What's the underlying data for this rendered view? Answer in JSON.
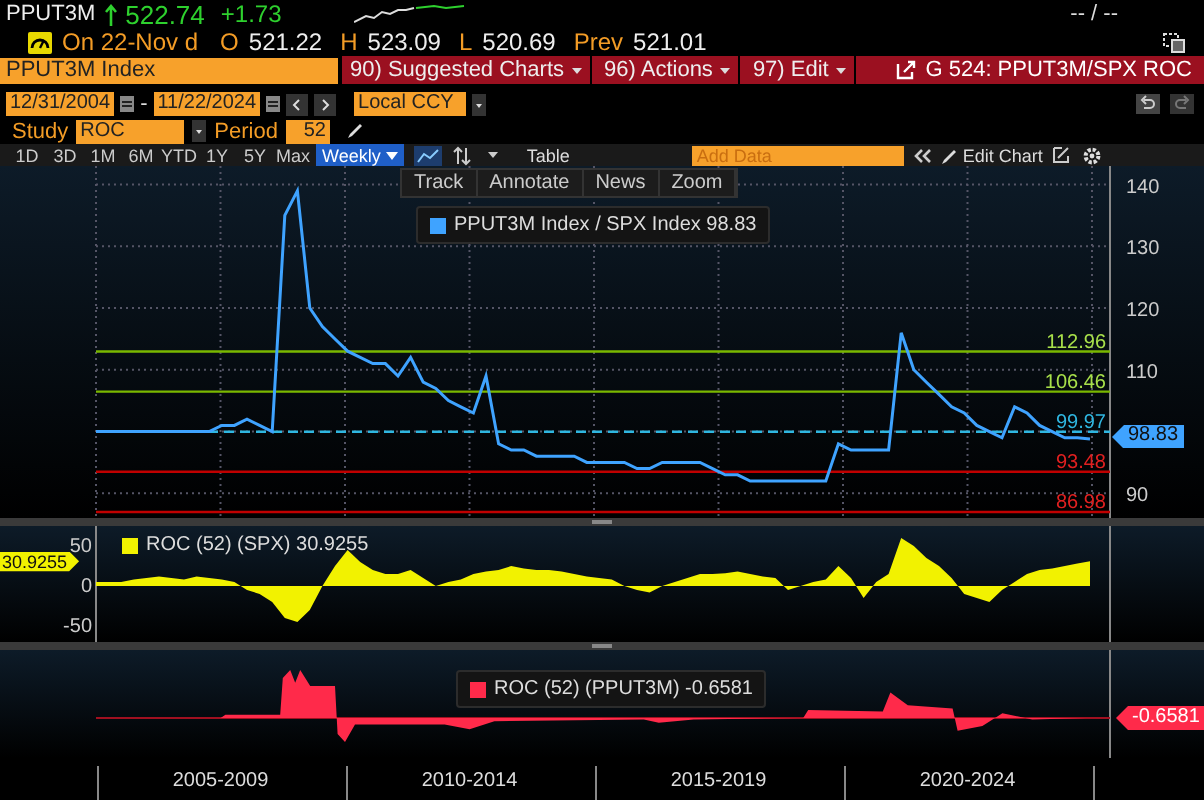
{
  "quote": {
    "ticker": "PPUT3M",
    "last": "522.74",
    "change": "+1.73",
    "bid_ask": "-- / --",
    "date": "On 22-Nov d",
    "fields": [
      {
        "label": "O",
        "value": "521.22"
      },
      {
        "label": "H",
        "value": "523.09"
      },
      {
        "label": "L",
        "value": "520.69"
      },
      {
        "label": "Prev",
        "value": "521.01"
      }
    ]
  },
  "toolbar": {
    "security": "PPUT3M Index",
    "menus": [
      {
        "number": "90)",
        "label": "Suggested Charts"
      },
      {
        "number": "96)",
        "label": "Actions"
      },
      {
        "number": "97)",
        "label": "Edit"
      }
    ],
    "chart_title": "G 524: PPUT3M/SPX ROC"
  },
  "range": {
    "start": "12/31/2004",
    "separator": "-",
    "end": "11/22/2024",
    "currency": "Local CCY"
  },
  "study": {
    "label": "Study",
    "value": "ROC",
    "period_label": "Period",
    "period": "52"
  },
  "periods": [
    {
      "label": "1D",
      "selected": false
    },
    {
      "label": "3D",
      "selected": false
    },
    {
      "label": "1M",
      "selected": false
    },
    {
      "label": "6M",
      "selected": false
    },
    {
      "label": "YTD",
      "selected": false
    },
    {
      "label": "1Y",
      "selected": false
    },
    {
      "label": "5Y",
      "selected": false
    },
    {
      "label": "Max",
      "selected": false
    }
  ],
  "frequency": "Weekly",
  "table_label": "Table",
  "add_data_placeholder": "Add Data",
  "edit_chart": "Edit Chart",
  "chart_tools": [
    "Track",
    "Annotate",
    "News",
    "Zoom"
  ],
  "main_chart": {
    "legend_value": "98.83",
    "tag_value": "98.83",
    "chart_data": {
      "type": "line",
      "grid": true,
      "series": [
        {
          "name": "PPUT3M Index / SPX Index",
          "color": "#3fa3ff",
          "values": [
            100,
            100,
            100,
            100,
            100,
            100,
            100,
            100,
            100,
            100,
            101,
            101,
            102,
            101,
            100,
            135,
            139,
            120,
            117,
            115,
            113,
            112,
            111,
            111,
            109,
            112,
            108,
            107,
            105,
            104,
            103,
            109,
            98,
            97,
            97,
            96,
            96,
            96,
            96,
            95,
            95,
            95,
            95,
            94,
            94,
            95,
            95,
            95,
            95,
            94,
            93,
            93,
            92,
            92,
            92,
            92,
            92,
            92,
            92,
            98,
            97,
            97,
            97,
            97,
            116,
            110,
            108,
            106,
            104,
            103,
            101,
            100,
            99,
            104,
            103,
            101,
            100,
            99,
            99,
            98.8
          ]
        }
      ],
      "ylim": [
        86,
        143
      ],
      "yticks": [
        90,
        110,
        120,
        130,
        140
      ],
      "ref_lines": [
        {
          "axis": "y",
          "value": 112.96,
          "label": "112.96",
          "color": "#7ab800"
        },
        {
          "axis": "y",
          "value": 106.46,
          "label": "106.46",
          "color": "#7ab800"
        },
        {
          "axis": "y",
          "value": 99.97,
          "label": "99.97",
          "color": "#2fb6e0"
        },
        {
          "axis": "y",
          "value": 93.48,
          "label": "93.48",
          "color": "#c00000"
        },
        {
          "axis": "y",
          "value": 86.98,
          "label": "86.98",
          "color": "#c00000"
        }
      ]
    }
  },
  "roc_spx": {
    "legend_value": "30.9255",
    "tag_value": "30.9255",
    "chart_data": {
      "type": "area",
      "series": [
        {
          "name": "ROC (52) (SPX)",
          "color": "#f2f200",
          "values": [
            5,
            5,
            5,
            8,
            10,
            12,
            10,
            8,
            12,
            10,
            8,
            5,
            -5,
            -10,
            -20,
            -40,
            -45,
            -30,
            0,
            25,
            45,
            30,
            20,
            15,
            15,
            20,
            10,
            0,
            5,
            8,
            15,
            18,
            20,
            25,
            22,
            20,
            20,
            18,
            15,
            12,
            10,
            8,
            0,
            -5,
            -8,
            0,
            5,
            10,
            15,
            15,
            16,
            18,
            15,
            12,
            10,
            -5,
            0,
            5,
            8,
            25,
            10,
            -15,
            5,
            15,
            60,
            50,
            35,
            25,
            10,
            -10,
            -15,
            -20,
            -5,
            5,
            15,
            20,
            22,
            25,
            28,
            31
          ]
        }
      ],
      "ylim": [
        -70,
        75
      ],
      "yticks": [
        -50,
        0,
        50
      ]
    }
  },
  "roc_pput": {
    "legend": "ROC (52) (PPUT3M) -0.6581",
    "last_value": "-0.6581"
  },
  "x_axis_labels": [
    "2005-2009",
    "2010-2014",
    "2015-2019",
    "2020-2024"
  ]
}
